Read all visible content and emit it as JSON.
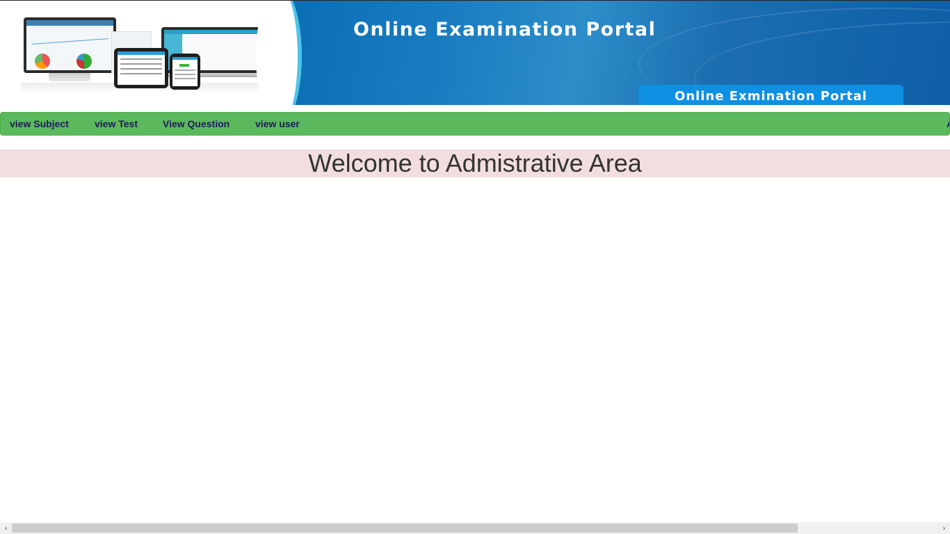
{
  "banner": {
    "title": "Online Examination Portal",
    "badge": "Online Exmination Portal"
  },
  "nav": {
    "items": [
      {
        "label": "view Subject"
      },
      {
        "label": "view Test"
      },
      {
        "label": "View Question"
      },
      {
        "label": "view user"
      },
      {
        "label": "A"
      }
    ]
  },
  "main": {
    "welcome": "Welcome to Admistrative Area"
  },
  "scrollbar": {
    "left_arrow": "‹",
    "right_arrow": "›"
  },
  "colors": {
    "nav_bg": "#5cb85c",
    "nav_text": "#1f1a5a",
    "welcome_bg": "#f2dede",
    "banner_blue": "#0d5ea6",
    "badge_blue": "#0f90e2"
  }
}
